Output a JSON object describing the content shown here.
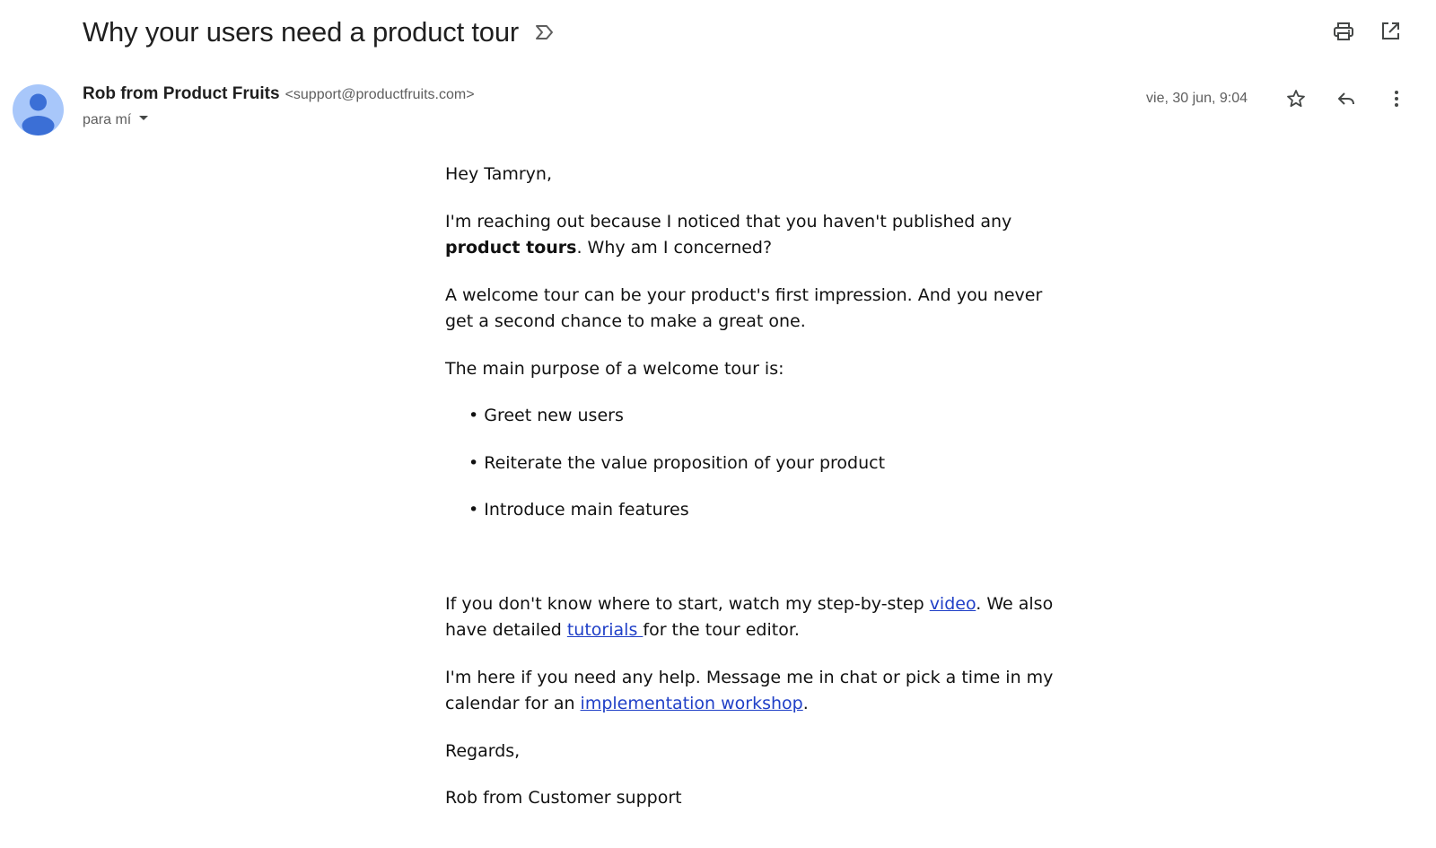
{
  "email": {
    "subject": "Why your users need a product tour",
    "sender": {
      "name": "Rob from Product Fruits",
      "email": "<support@productfruits.com>"
    },
    "recipient_label": "para mí",
    "date": "vie, 30 jun, 9:04"
  },
  "icons": {
    "label": "label-icon",
    "print": "print-icon",
    "open_new_window": "open-in-new-window-icon",
    "star": "star-icon",
    "reply": "reply-icon",
    "more": "more-vert-icon",
    "dropdown": "chevron-down-icon"
  },
  "body": {
    "greeting": "Hey Tamryn,",
    "p1_before": "I'm reaching out because I noticed that you haven't published any ",
    "p1_bold": "product tours",
    "p1_after": ". Why am I concerned?",
    "p2": "A welcome tour can be your product's first impression. And you never get a second chance to make a great one.",
    "p3": "The main purpose of a welcome tour is:",
    "bullets": [
      "Greet new users",
      "Reiterate the value proposition of your product",
      "Introduce main features"
    ],
    "p4_before": "If you don't know where to start, watch my step-by-step ",
    "p4_link1": "video",
    "p4_middle": ". We also have detailed ",
    "p4_link2": "tutorials ",
    "p4_after": "for the tour editor.",
    "p5_before": "I'm here if you need any help. Message me in chat or pick a time in my calendar for an ",
    "p5_link": "implementation workshop",
    "p5_after": ".",
    "closing": "Regards,",
    "signature": "Rob from Customer support"
  },
  "colors": {
    "avatar_bg": "#a8c7fa",
    "avatar_fg": "#3b6fd6",
    "link": "#1f3fc7",
    "icon": "#444746"
  }
}
